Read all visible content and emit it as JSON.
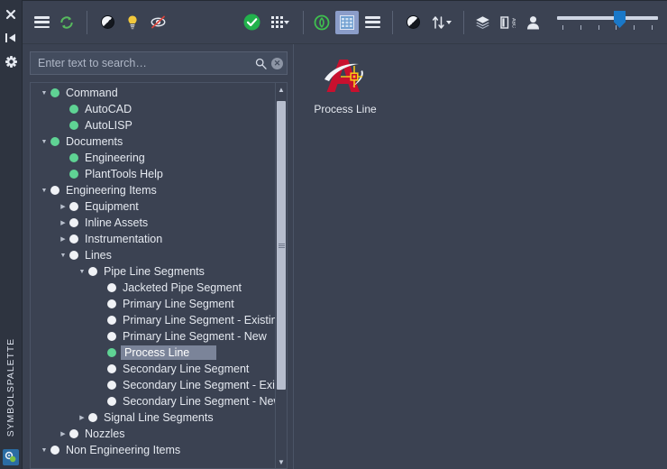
{
  "rail": {
    "icons": [
      {
        "name": "close-icon",
        "glyph": "✖"
      },
      {
        "name": "collapse-panel-icon",
        "glyph": "▶|"
      },
      {
        "name": "settings-gear-icon",
        "glyph": "⚙"
      }
    ],
    "title": "SYMBOLSPALETTE",
    "bottom_icon": "plant-tools-icon"
  },
  "toolbar": {
    "left": [
      {
        "name": "menu-button",
        "icon": "hamburger-icon",
        "label": "Menu"
      },
      {
        "name": "refresh-button",
        "icon": "refresh-circular-arrows-icon",
        "label": "Refresh"
      },
      {
        "name": "contrast-button",
        "icon": "half-circle-contrast-icon",
        "label": "Contrast"
      },
      {
        "name": "tips-button",
        "icon": "lightbulb-icon",
        "label": "Tips"
      },
      {
        "name": "hide-preview-button",
        "icon": "no-preview-icon",
        "label": "Hide Preview"
      }
    ],
    "right": [
      {
        "name": "apply-button",
        "icon": "green-check-circle-icon",
        "label": "Apply"
      },
      {
        "name": "grid-options-button",
        "icon": "dots-grid-icon",
        "label": "Grid Options"
      },
      {
        "name": "shape-button",
        "icon": "green-hexagon-icon",
        "label": "Shape"
      },
      {
        "name": "grid-view-button",
        "icon": "grid-view-icon",
        "label": "Grid View"
      },
      {
        "name": "list-view-button",
        "icon": "list-view-icon",
        "label": "List View"
      },
      {
        "name": "theme-button",
        "icon": "half-circle-contrast-icon",
        "label": "Theme"
      },
      {
        "name": "sort-button",
        "icon": "sort-arrows-icon",
        "label": "Sort"
      },
      {
        "name": "layers-button",
        "icon": "layers-stack-icon",
        "label": "Layers"
      },
      {
        "name": "text-label-button",
        "icon": "abc-label-icon",
        "label": "Labels"
      },
      {
        "name": "user-button",
        "icon": "person-icon",
        "label": "User"
      }
    ],
    "slider": {
      "name": "zoom-slider",
      "value": 60,
      "min": 0,
      "max": 100,
      "tick_count": 6
    }
  },
  "search": {
    "placeholder": "Enter text to search…",
    "value": "",
    "search_icon": "magnifier-icon",
    "clear_icon": "clear-circle-icon",
    "clear_glyph": "✕"
  },
  "tree": {
    "nodes": [
      {
        "label": "Command",
        "indent": 0,
        "state": "expanded",
        "dot": "green"
      },
      {
        "label": "AutoCAD",
        "indent": 1,
        "state": "leaf",
        "dot": "green"
      },
      {
        "label": "AutoLISP",
        "indent": 1,
        "state": "leaf",
        "dot": "green"
      },
      {
        "label": "Documents",
        "indent": 0,
        "state": "expanded",
        "dot": "green"
      },
      {
        "label": "Engineering",
        "indent": 1,
        "state": "leaf",
        "dot": "green"
      },
      {
        "label": "PlantTools Help",
        "indent": 1,
        "state": "leaf",
        "dot": "green"
      },
      {
        "label": "Engineering Items",
        "indent": 0,
        "state": "expanded",
        "dot": "white"
      },
      {
        "label": "Equipment",
        "indent": 1,
        "state": "collapsed",
        "dot": "white"
      },
      {
        "label": "Inline Assets",
        "indent": 1,
        "state": "collapsed",
        "dot": "white"
      },
      {
        "label": "Instrumentation",
        "indent": 1,
        "state": "collapsed",
        "dot": "white"
      },
      {
        "label": "Lines",
        "indent": 1,
        "state": "expanded",
        "dot": "white"
      },
      {
        "label": "Pipe Line Segments",
        "indent": 2,
        "state": "expanded",
        "dot": "white"
      },
      {
        "label": "Jacketed Pipe Segment",
        "indent": 3,
        "state": "leaf",
        "dot": "white"
      },
      {
        "label": "Primary Line Segment",
        "indent": 3,
        "state": "leaf",
        "dot": "white"
      },
      {
        "label": "Primary Line Segment - Existing",
        "indent": 3,
        "state": "leaf",
        "dot": "white"
      },
      {
        "label": "Primary Line Segment - New",
        "indent": 3,
        "state": "leaf",
        "dot": "white"
      },
      {
        "label": "Process Line",
        "indent": 3,
        "state": "leaf",
        "dot": "green",
        "selected": true
      },
      {
        "label": "Secondary Line Segment",
        "indent": 3,
        "state": "leaf",
        "dot": "white"
      },
      {
        "label": "Secondary Line Segment - Exist…",
        "indent": 3,
        "state": "leaf",
        "dot": "white"
      },
      {
        "label": "Secondary Line Segment - New",
        "indent": 3,
        "state": "leaf",
        "dot": "white"
      },
      {
        "label": "Signal Line Segments",
        "indent": 2,
        "state": "collapsed",
        "dot": "white"
      },
      {
        "label": "Nozzles",
        "indent": 1,
        "state": "collapsed",
        "dot": "white"
      },
      {
        "label": "Non Engineering Items",
        "indent": 0,
        "state": "expanded",
        "dot": "white"
      }
    ],
    "scrollbar": {
      "up_glyph": "▲",
      "down_glyph": "▼"
    }
  },
  "content": {
    "items": [
      {
        "name": "symbol-process-line",
        "caption": "Process Line",
        "icon": "autocad-a-symbol-icon"
      }
    ]
  },
  "colors": {
    "panel_bg": "#3b4252",
    "rail_bg": "#2e3440",
    "accent_green": "#5fd394",
    "accent_blue": "#1a78c8",
    "selection": "#7b8499",
    "text": "#e5e9f0"
  }
}
